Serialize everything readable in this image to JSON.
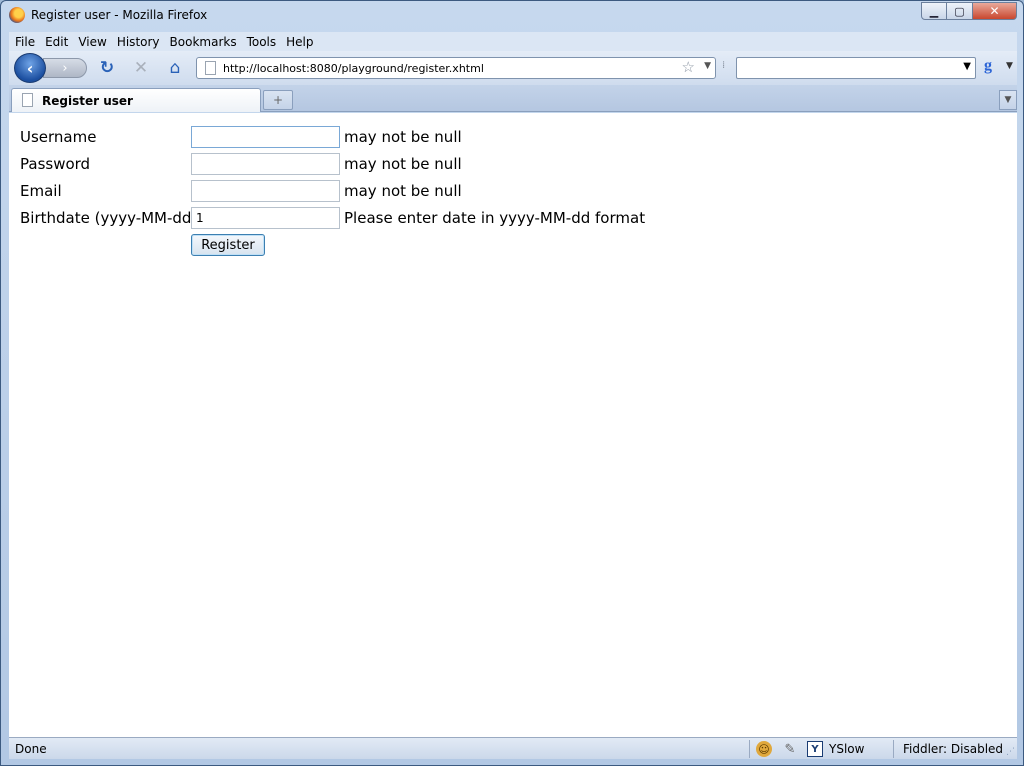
{
  "window": {
    "title": "Register user - Mozilla Firefox"
  },
  "menu": [
    "File",
    "Edit",
    "View",
    "History",
    "Bookmarks",
    "Tools",
    "Help"
  ],
  "navbar": {
    "url": "http://localhost:8080/playground/register.xhtml",
    "search_value": ""
  },
  "tab": {
    "label": "Register user",
    "new_tab_glyph": "+"
  },
  "form": {
    "fields": [
      {
        "label": "Username",
        "value": "",
        "message": "may not be null"
      },
      {
        "label": "Password",
        "value": "",
        "message": "may not be null"
      },
      {
        "label": "Email",
        "value": "",
        "message": "may not be null"
      },
      {
        "label": "Birthdate (yyyy-MM-dd)",
        "value": "1",
        "message": "Please enter date in yyyy-MM-dd format"
      }
    ],
    "submit_label": "Register"
  },
  "status": {
    "text": "Done",
    "yslow": "YSlow",
    "fiddler": "Fiddler: Disabled"
  },
  "icons": {
    "back": "arrow-left",
    "forward": "arrow-right",
    "reload": "reload",
    "stop": "stop",
    "home": "home",
    "bookmark": "star",
    "search_engine": "google"
  },
  "colors": {
    "accent": "#1c4fa0",
    "frame": "#b2c8e4",
    "field_border": "#b7c1cc"
  }
}
